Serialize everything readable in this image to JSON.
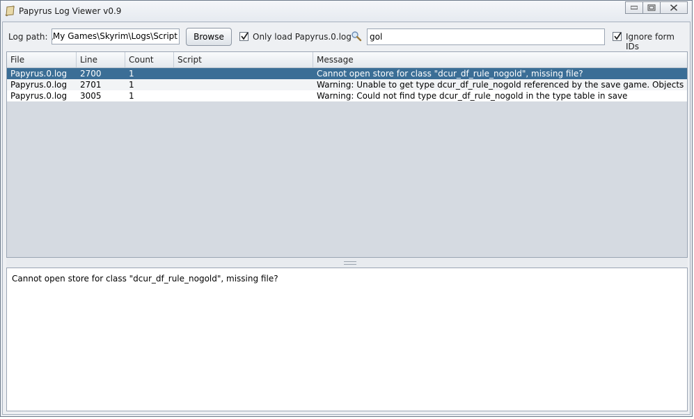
{
  "window": {
    "title": "Papyrus Log Viewer v0.9"
  },
  "toolbar": {
    "log_path_label": "Log path:",
    "log_path_value": "s\\My Games\\Skyrim\\Logs\\Script\\",
    "browse_label": "Browse",
    "only_papyrus_label": "Only load Papyrus.0.log",
    "only_papyrus_checked": true,
    "search_value": "gol",
    "ignore_form_ids_label": "Ignore form IDs",
    "ignore_form_ids_checked": true
  },
  "table": {
    "columns": [
      "File",
      "Line",
      "Count",
      "Script",
      "Message"
    ],
    "rows": [
      {
        "file": "Papyrus.0.log",
        "line": "2700",
        "count": "1",
        "script": "",
        "message": "Cannot open store for class \"dcur_df_rule_nogold\", missing file?",
        "selected": true
      },
      {
        "file": "Papyrus.0.log",
        "line": "2701",
        "count": "1",
        "script": "",
        "message": "Warning: Unable to get type dcur_df_rule_nogold referenced by the save game. Objects of this ...",
        "selected": false
      },
      {
        "file": "Papyrus.0.log",
        "line": "3005",
        "count": "1",
        "script": "",
        "message": "Warning: Could not find type dcur_df_rule_nogold in the type table in save",
        "selected": false
      }
    ]
  },
  "detail": {
    "text": "Cannot open store for class \"dcur_df_rule_nogold\", missing file?"
  },
  "colors": {
    "selection": "#3b6e96",
    "table_bg": "#d5dae1"
  }
}
